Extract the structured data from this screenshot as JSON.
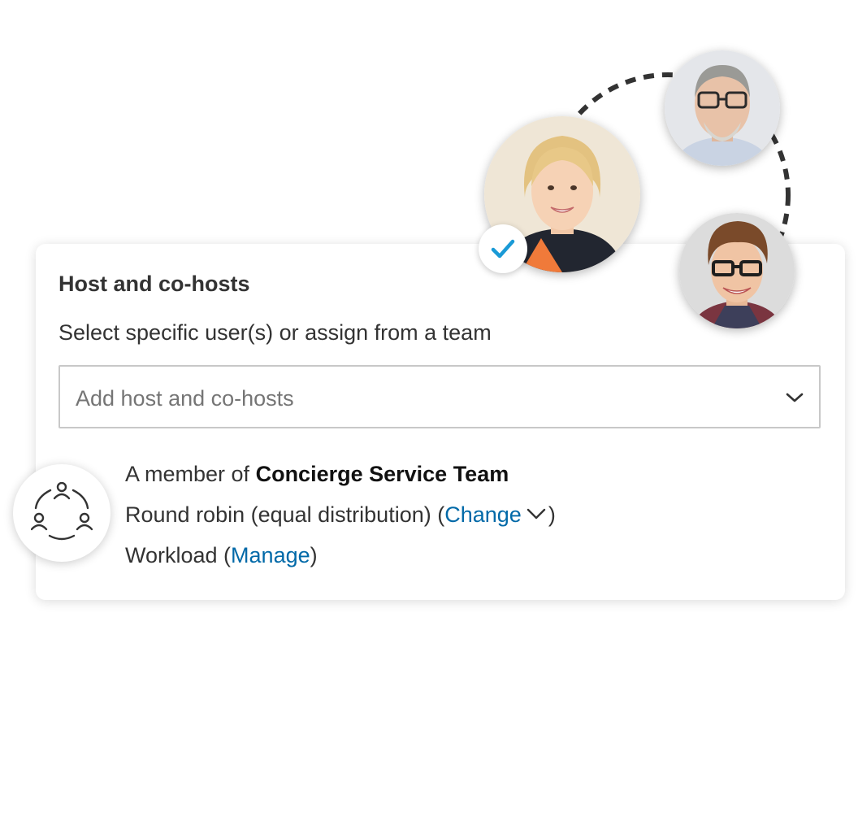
{
  "card": {
    "title": "Host and co-hosts",
    "subtitle": "Select specific user(s) or assign from a team",
    "select": {
      "placeholder": "Add host and co-hosts",
      "icon": "chevron-down-icon"
    },
    "team": {
      "prefix": "A member of ",
      "name": "Concierge Service Team",
      "distribution_text": "Round robin (equal distribution) (",
      "change_link": "Change",
      "distribution_close": ")",
      "workload_text": "Workload (",
      "manage_link": "Manage",
      "workload_close": ")",
      "icon": "team-cycle-icon"
    }
  },
  "avatars": [
    {
      "person": "woman-blonde",
      "selected": true
    },
    {
      "person": "older-man-glasses",
      "selected": false
    },
    {
      "person": "young-man-glasses",
      "selected": false
    }
  ],
  "colors": {
    "link": "#0069a8",
    "check": "#1a9ad6",
    "text": "#333333",
    "ring": "#333333"
  }
}
